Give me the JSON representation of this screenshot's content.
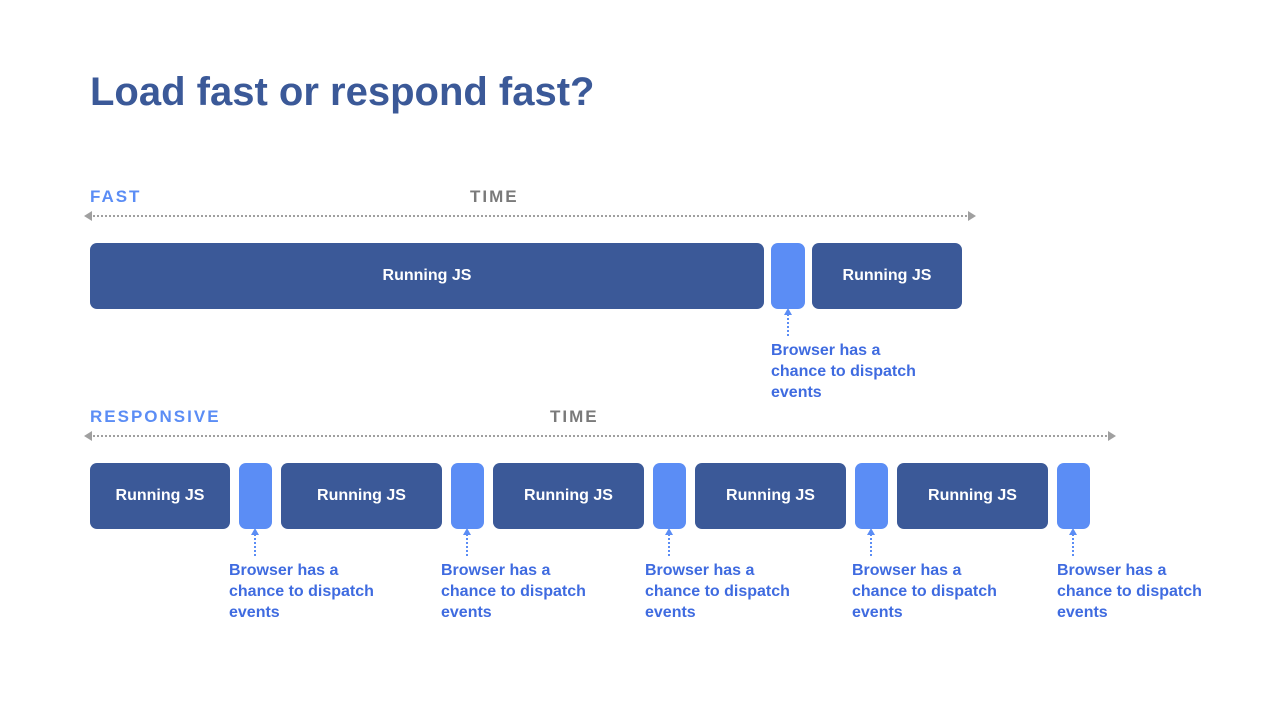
{
  "title": "Load fast or respond fast?",
  "time_label": "TIME",
  "js_label": "Running JS",
  "dispatch_caption": "Browser has a chance to dispatch events",
  "colors": {
    "js_block": "#3b5998",
    "gap_block": "#5b8df5",
    "title": "#3b5998",
    "accent": "#5b8df5",
    "caption": "#3f6be0",
    "axis": "#a0a0a0"
  },
  "sections": {
    "fast": {
      "label": "FAST",
      "blocks": [
        "js",
        "gap",
        "js"
      ]
    },
    "responsive": {
      "label": "RESPONSIVE",
      "blocks": [
        "js",
        "gap",
        "js",
        "gap",
        "js",
        "gap",
        "js",
        "gap",
        "js",
        "gap"
      ]
    }
  }
}
